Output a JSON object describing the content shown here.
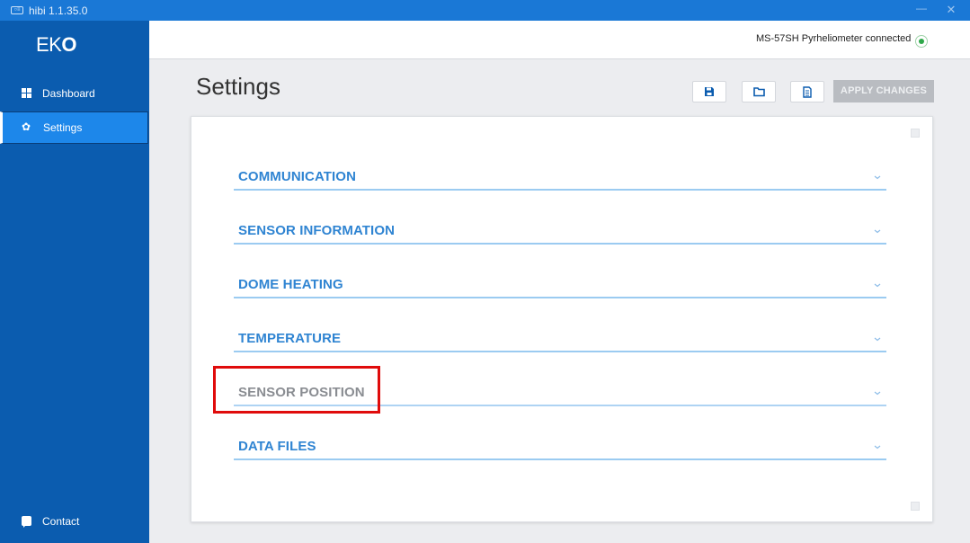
{
  "titlebar": {
    "app_icon": "app-icon",
    "title": "hibi 1.1.35.0",
    "minimize_glyph": "—",
    "close_glyph": "✕"
  },
  "sidebar": {
    "logo": {
      "text_prefix": "EK",
      "text_suffix": "O"
    },
    "items": [
      {
        "label": "Dashboard",
        "icon": "dashboard-icon"
      },
      {
        "label": "Settings",
        "icon": "gear-icon",
        "active": true
      },
      {
        "label": "Contact",
        "icon": "chat-icon"
      }
    ]
  },
  "status": {
    "text": "MS-57SH Pyrheliometer connected",
    "state_color": "#2ea84a"
  },
  "page": {
    "title": "Settings"
  },
  "toolbar": {
    "save_icon": "save-icon",
    "open_icon": "folder-icon",
    "doc_icon": "document-icon",
    "apply_label": "APPLY CHANGES"
  },
  "sections": [
    {
      "label": "COMMUNICATION"
    },
    {
      "label": "SENSOR INFORMATION"
    },
    {
      "label": "DOME HEATING"
    },
    {
      "label": "TEMPERATURE"
    },
    {
      "label": "SENSOR POSITION",
      "muted": true
    },
    {
      "label": "DATA FILES"
    }
  ],
  "colors": {
    "sidebar": "#0b5caf",
    "accent": "#2f84d2",
    "highlight": "#e00b0b"
  }
}
